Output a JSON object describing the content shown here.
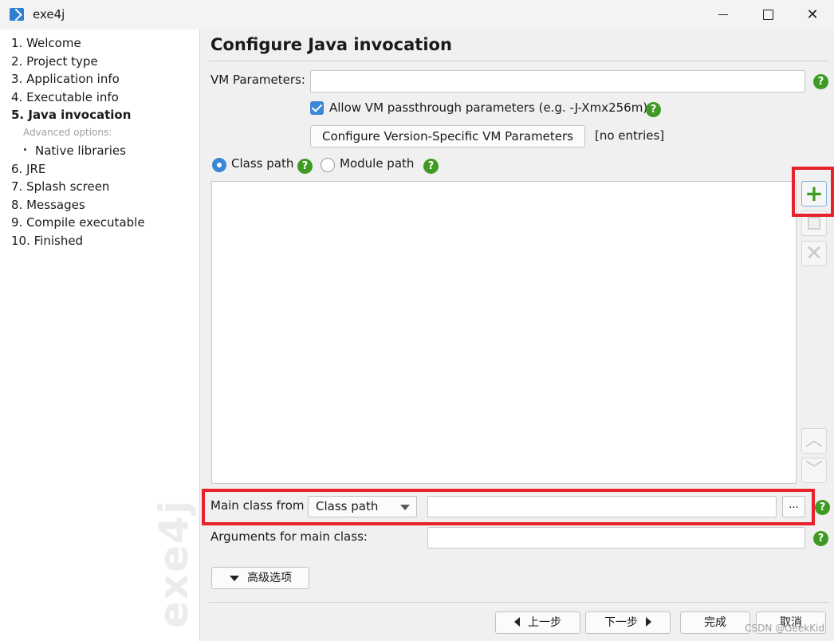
{
  "window": {
    "title": "exe4j"
  },
  "nav": {
    "items": [
      {
        "label": "1. Welcome"
      },
      {
        "label": "2. Project type"
      },
      {
        "label": "3. Application info"
      },
      {
        "label": "4. Executable info"
      },
      {
        "label": "5. Java invocation"
      },
      {
        "label": "6. JRE"
      },
      {
        "label": "7. Splash screen"
      },
      {
        "label": "8. Messages"
      },
      {
        "label": "9. Compile executable"
      },
      {
        "label": "10. Finished"
      }
    ],
    "advanced_label": "Advanced options:",
    "sub_items": [
      {
        "label": "Native libraries"
      }
    ],
    "watermark": "exe4j"
  },
  "page": {
    "title": "Configure Java invocation",
    "vm_params_label": "VM Parameters:",
    "vm_params_value": "",
    "allow_passthrough_label": "Allow VM passthrough parameters (e.g. -J-Xmx256m)",
    "allow_passthrough_checked": true,
    "configure_version_button": "Configure Version-Specific VM Parameters",
    "configure_version_status": "[no entries]",
    "classpath_radio": "Class path",
    "modulepath_radio": "Module path",
    "selected_path_mode": "Class path",
    "main_class_from_label": "Main class from",
    "main_class_source": "Class path",
    "main_class_value": "",
    "browse_button": "...",
    "arguments_label": "Arguments for main class:",
    "arguments_value": "",
    "advanced_button": "高级选项"
  },
  "footer": {
    "back": "上一步",
    "next": "下一步",
    "finish": "完成",
    "cancel": "取消"
  },
  "credit": "CSDN @GeekKid",
  "colors": {
    "accent": "#3b86d6",
    "help": "#3e9a23",
    "highlight": "#e8222a"
  }
}
